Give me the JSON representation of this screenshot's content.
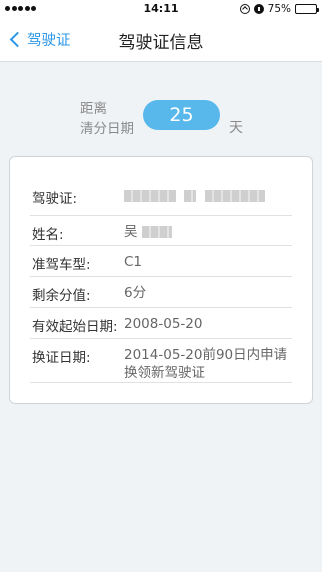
{
  "status_bar": {
    "time": "14:11",
    "battery": "75%",
    "battery_level": 0.75
  },
  "nav": {
    "back_label": "驾驶证",
    "title": "驾驶证信息"
  },
  "countdown": {
    "label_line1": "距离",
    "label_line2": "清分日期",
    "days": "25",
    "unit": "天"
  },
  "details": [
    {
      "label": "驾驶证:",
      "value": ""
    },
    {
      "label": "姓名:",
      "value": "吴"
    },
    {
      "label": "准驾车型:",
      "value": "C1"
    },
    {
      "label": "剩余分值:",
      "value": "6分"
    },
    {
      "label": "有效起始日期:",
      "value": "2008-05-20"
    },
    {
      "label": "换证日期:",
      "value": "2014-05-20前90日内申请换领新驾驶证"
    }
  ]
}
